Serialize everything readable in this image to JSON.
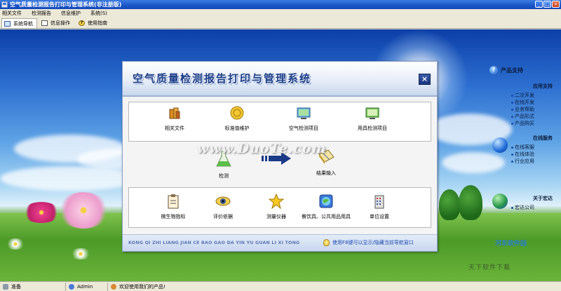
{
  "window": {
    "title": "空气质量检测报告打印与管理系统(非注册版)",
    "min_glyph": "_",
    "max_glyph": "□",
    "close_glyph": "×"
  },
  "menu": [
    "相关文件",
    "检测报告",
    "信息维护",
    "系统(S)"
  ],
  "tabs": [
    {
      "label": "系统导航",
      "icon": "monitor-icon",
      "active": true
    },
    {
      "label": "信息操作",
      "icon": "document-icon",
      "active": false
    },
    {
      "label": "使用指南",
      "icon": "help-icon",
      "active": false
    }
  ],
  "dialog": {
    "title": "空气质量检测报告打印与管理系统",
    "close_glyph": "×",
    "row1": [
      {
        "label": "相关文件",
        "icon": "books-icon"
      },
      {
        "label": "标准值维护",
        "icon": "coin-icon"
      },
      {
        "label": "空气检测项目",
        "icon": "monitor-screen-icon"
      },
      {
        "label": "用具检测项目",
        "icon": "green-screen-icon"
      }
    ],
    "middle": [
      {
        "label": "检测",
        "icon": "flask-icon"
      },
      {
        "label": "结果输入",
        "icon": "notebook-icon"
      }
    ],
    "row2": [
      {
        "label": "微生物指标",
        "icon": "clipboard-icon"
      },
      {
        "label": "评价依据",
        "icon": "eye-icon"
      },
      {
        "label": "测量仪器",
        "icon": "star-icon"
      },
      {
        "label": "餐饮具、公共用品用具",
        "icon": "globe-icon"
      },
      {
        "label": "单位设置",
        "icon": "building-icon"
      }
    ],
    "footer_pinyin": "KONG QI ZHI LIANG JIAN CE BAO GAO DA YIN YU GUAN LI XI TONG",
    "footer_hint": "使用F8键可以显示/隐藏当前导航窗口",
    "watermark": "www.DuoTe.com"
  },
  "side_panel": {
    "title": "产品支持",
    "groups": [
      {
        "title": "应用支持",
        "items": [
          "二次开发",
          "在线开发",
          "业务帮助",
          "产品形式",
          "产品购买"
        ]
      },
      {
        "title": "在线服务",
        "items": [
          "在线客服",
          "在线体验",
          "行业应用"
        ]
      },
      {
        "title": "关于宏达",
        "items": [
          "宏达公司"
        ]
      }
    ]
  },
  "desktop": {
    "corner_logo": "河东软件园",
    "corner_sub": "天下软件下载"
  },
  "status": {
    "ready": "准备",
    "user": "Admin",
    "welcome": "欢迎使用我们的产品!"
  },
  "colors": {
    "title_bar": "#1a55c8",
    "dialog_title": "#1a3c88",
    "hint_text": "#1a4ab0"
  }
}
